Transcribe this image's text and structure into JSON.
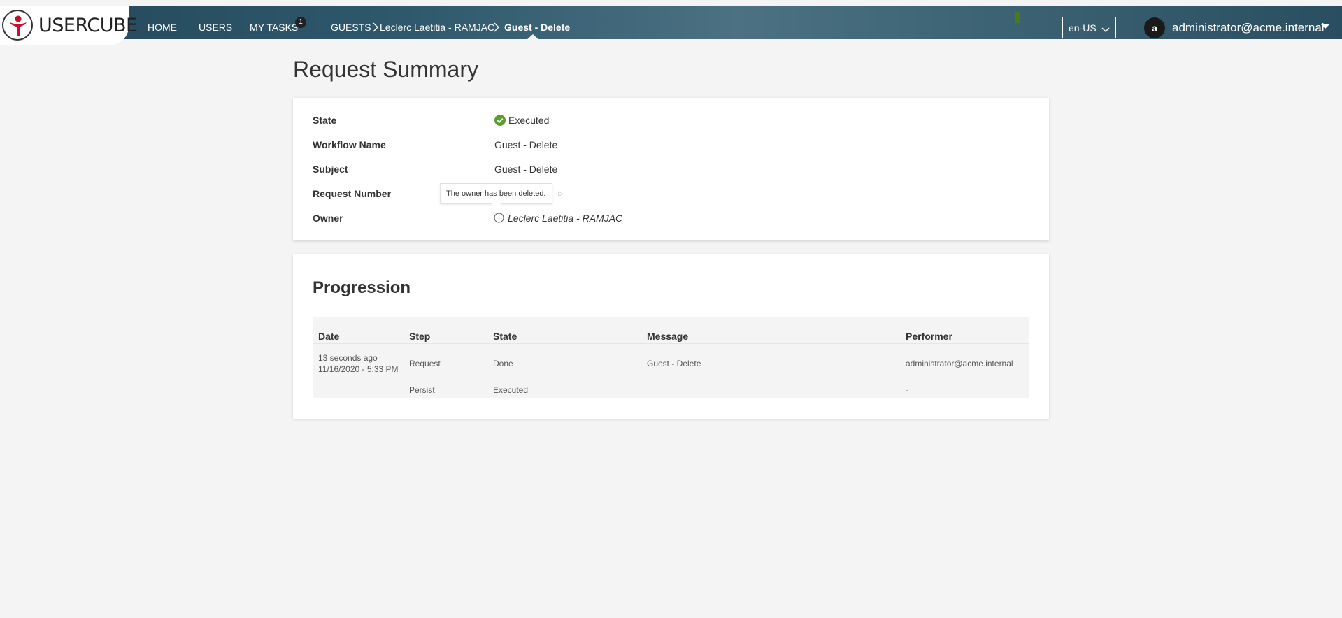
{
  "header": {
    "logo_text": "USERCUBE",
    "nav": [
      {
        "label": "HOME"
      },
      {
        "label": "USERS"
      },
      {
        "label": "MY TASKS",
        "badge": "1"
      }
    ],
    "breadcrumb": [
      {
        "label": "GUESTS"
      },
      {
        "label": "Leclerc Laetitia - RAMJAC"
      },
      {
        "label": "Guest - Delete",
        "current": true
      }
    ],
    "language": "en-US",
    "user": {
      "initial": "a",
      "name": "administrator@acme.internal"
    }
  },
  "page": {
    "title": "Request Summary"
  },
  "summary": {
    "fields": [
      {
        "label": "State",
        "value": "Executed",
        "icon": "check-circle-icon"
      },
      {
        "label": "Workflow Name",
        "value": "Guest - Delete"
      },
      {
        "label": "Subject",
        "value": "Guest - Delete"
      },
      {
        "label": "Request Number",
        "value": ""
      },
      {
        "label": "Owner",
        "value": "Leclerc Laetitia - RAMJAC",
        "icon": "info-icon"
      }
    ],
    "tooltip": "The owner has been deleted."
  },
  "progression": {
    "title": "Progression",
    "columns": [
      "Date",
      "Step",
      "State",
      "Message",
      "Performer"
    ],
    "rows": [
      {
        "date_relative": "13 seconds ago",
        "date": "11/16/2020 - 5:33 PM",
        "step": "Request",
        "state": "Done",
        "message": "Guest - Delete",
        "performer": "administrator@acme.internal"
      },
      {
        "date_relative": "",
        "date": "",
        "step": "Persist",
        "state": "Executed",
        "message": "",
        "performer": "-"
      }
    ]
  },
  "colors": {
    "header_dark": "#24475a",
    "header_light": "#4b7182",
    "success": "#5a9e2f",
    "background": "#f4f4f4"
  }
}
